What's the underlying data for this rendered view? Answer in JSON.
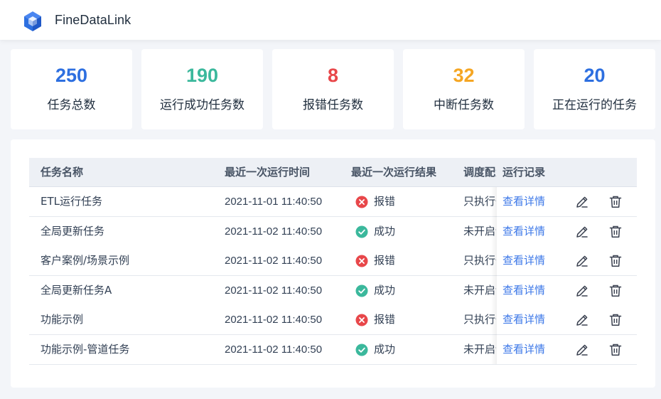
{
  "app": {
    "name": "FineDataLink"
  },
  "stats": [
    {
      "value": "250",
      "label": "任务总数",
      "color": "#2d6fe0"
    },
    {
      "value": "190",
      "label": "运行成功任务数",
      "color": "#3bb89c"
    },
    {
      "value": "8",
      "label": "报错任务数",
      "color": "#e8474a"
    },
    {
      "value": "32",
      "label": "中断任务数",
      "color": "#f5a623"
    },
    {
      "value": "20",
      "label": "正在运行的任务",
      "color": "#2d6fe0"
    }
  ],
  "table": {
    "headers": {
      "name": "任务名称",
      "last_time": "最近一次运行时间",
      "last_result": "最近一次运行结果",
      "schedule": "调度配置",
      "records": "运行记录"
    },
    "rows": [
      {
        "name": "ETL运行任务",
        "time": "2021-11-01 11:40:50",
        "result": "报错",
        "status": "error",
        "schedule": "只执行一次",
        "link": "查看详情"
      },
      {
        "name": "全局更新任务",
        "time": "2021-11-02 11:40:50",
        "result": "成功",
        "status": "success",
        "schedule": "未开启调度",
        "link": "查看详情"
      },
      {
        "name": "客户案例/场景示例",
        "time": "2021-11-02 11:40:50",
        "result": "报错",
        "status": "error",
        "schedule": "只执行一次",
        "link": "查看详情"
      },
      {
        "name": "全局更新任务A",
        "time": "2021-11-02 11:40:50",
        "result": "成功",
        "status": "success",
        "schedule": "未开启调度",
        "link": "查看详情"
      },
      {
        "name": "功能示例",
        "time": "2021-11-02 11:40:50",
        "result": "报错",
        "status": "error",
        "schedule": "只执行一次",
        "link": "查看详情"
      },
      {
        "name": "功能示例-管道任务",
        "time": "2021-11-02 11:40:50",
        "result": "成功",
        "status": "success",
        "schedule": "未开启调度",
        "link": "查看详情"
      }
    ]
  },
  "icons": {
    "logo": "cube-logo-icon",
    "error": "x-circle-icon",
    "success": "check-circle-icon",
    "edit": "edit-pencil-icon",
    "delete": "trash-icon"
  },
  "colors": {
    "error": "#e8474a",
    "success": "#3bb89c",
    "link": "#3d78e8",
    "brand": "#2d6fe0"
  }
}
